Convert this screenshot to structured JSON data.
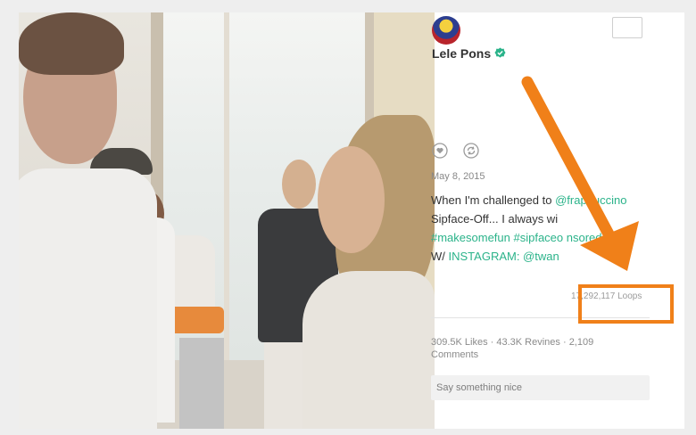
{
  "post": {
    "author": "Lele Pons",
    "date": "May 8, 2015",
    "description": {
      "line1": "When I'm challenged to",
      "line1_tag": "@frappuccino",
      "line2": "Sipface-Off... I always wi",
      "tags_line": "#makesomefun #sipfaceo   nsored",
      "line4_prefix": "W/",
      "line4_tag": "INSTAGRAM: @twan"
    },
    "loops": "17,292,117 Loops",
    "stats": "309.5K Likes · 43.3K Revines · 2,109 Comments",
    "comment_placeholder": "Say something nice"
  },
  "icons": {
    "like": "heart-icon",
    "revine": "revine-icon",
    "verified": "verified-badge-icon",
    "more": "more-button"
  },
  "colors": {
    "accent": "#2bb38a",
    "annotation": "#f08019",
    "text": "#333333",
    "muted": "#888888"
  }
}
